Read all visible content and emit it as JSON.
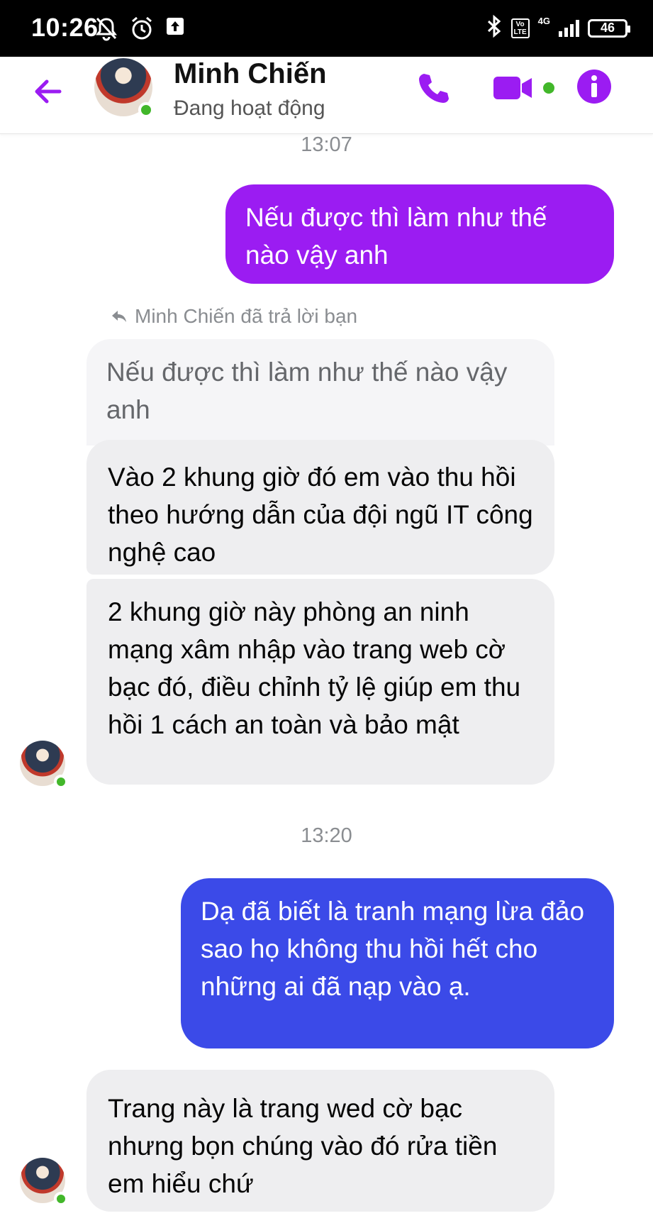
{
  "status_bar": {
    "time": "10:26",
    "battery": "46",
    "network": "4G",
    "volte": "Vo LTE"
  },
  "header": {
    "name": "Minh Chiến",
    "status": "Đang hoạt động",
    "accent_color": "#9b1cf2",
    "online_color": "#42b72a"
  },
  "chat": {
    "time1": "13:07",
    "msg_out1": "Nếu được thì làm như thế nào vậy anh",
    "reply_label": "Minh Chiến đã trả lời bạn",
    "quoted": "Nếu được thì làm như thế nào vậy anh",
    "msg_in1": "Vào 2 khung giờ đó em vào thu hồi theo hướng dẫn của đội ngũ IT công nghệ cao",
    "msg_in2": "2 khung giờ này phòng an ninh mạng xâm nhập vào trang web cờ bạc đó, điều chỉnh tỷ lệ giúp em thu hồi 1 cách an toàn và bảo mật",
    "time2": "13:20",
    "msg_out2": "Dạ đã biết là tranh mạng lừa đảo sao họ không thu hồi hết cho những ai đã nạp vào ạ.",
    "msg_in3": "Trang này là trang wed cờ bạc nhưng bọn chúng vào đó rửa tiền em hiểu chứ"
  }
}
